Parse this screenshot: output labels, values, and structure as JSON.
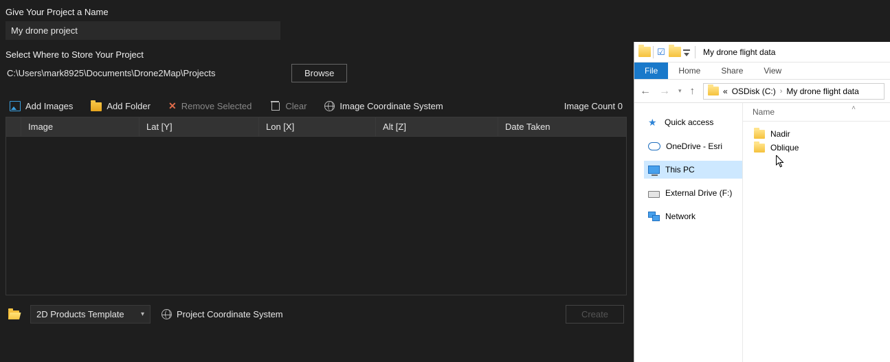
{
  "labels": {
    "name_prompt": "Give Your Project a Name",
    "store_prompt": "Select Where to Store Your Project"
  },
  "project": {
    "name": "My drone project",
    "path": "C:\\Users\\mark8925\\Documents\\Drone2Map\\Projects",
    "browse": "Browse"
  },
  "toolbar": {
    "add_images": "Add Images",
    "add_folder": "Add Folder",
    "remove_selected": "Remove Selected",
    "clear": "Clear",
    "image_cs": "Image Coordinate System",
    "count_label": "Image Count 0"
  },
  "table": {
    "headers": {
      "image": "Image",
      "lat": "Lat [Y]",
      "lon": "Lon [X]",
      "alt": "Alt [Z]",
      "date": "Date Taken"
    }
  },
  "bottom": {
    "template": "2D Products Template",
    "project_cs": "Project Coordinate System",
    "create": "Create"
  },
  "explorer": {
    "title": "My drone flight data",
    "ribbon": {
      "file": "File",
      "home": "Home",
      "share": "Share",
      "view": "View"
    },
    "breadcrumb": {
      "pre": "«",
      "drive": "OSDisk (C:)",
      "folder": "My drone flight data"
    },
    "listhead": "Name",
    "nav": {
      "quick": "Quick access",
      "onedrive": "OneDrive - Esri",
      "thispc": "This PC",
      "external": "External Drive (F:)",
      "network": "Network"
    },
    "items": [
      {
        "name": "Nadir"
      },
      {
        "name": "Oblique"
      }
    ]
  }
}
